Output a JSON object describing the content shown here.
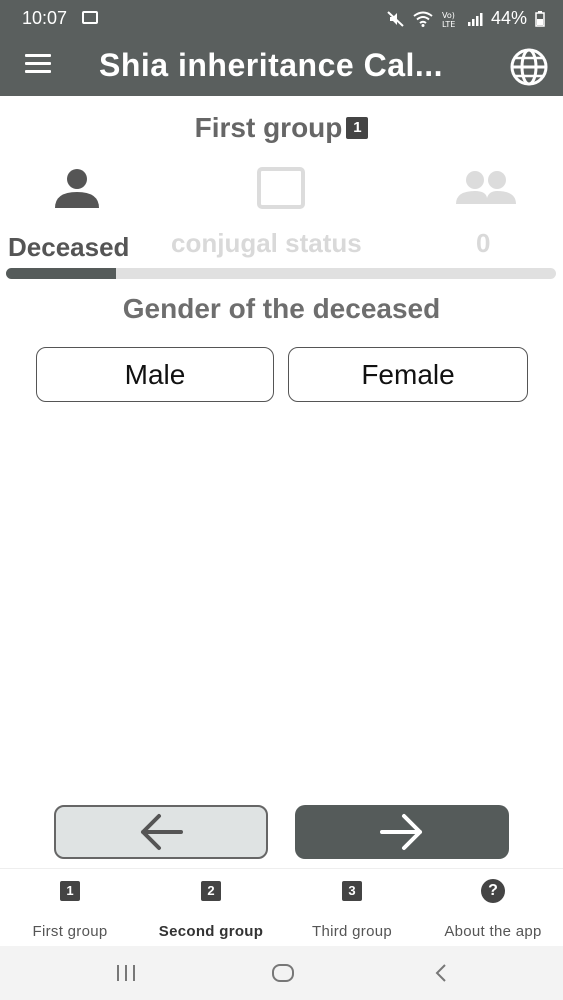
{
  "status_bar": {
    "time": "10:07",
    "battery": "44%",
    "icons": [
      "image-icon",
      "mute-icon",
      "wifi-icon",
      "volte-icon",
      "signal-icon",
      "battery-icon"
    ]
  },
  "app_bar": {
    "title": "Shia inheritance Cal...",
    "menu_icon": "menu-icon",
    "language_icon": "globe-icon"
  },
  "header": {
    "group_title": "First group",
    "group_badge": "1"
  },
  "steps": [
    {
      "label": "Deceased",
      "icon": "person-icon",
      "active": true
    },
    {
      "label": "conjugal status",
      "icon": "checkbox-icon",
      "active": false
    },
    {
      "label": "0",
      "icon": "people-icon",
      "active": false
    }
  ],
  "progress": {
    "fraction": 0.2
  },
  "question": "Gender of the deceased",
  "choices": {
    "male": "Male",
    "female": "Female"
  },
  "nav_buttons": {
    "back_icon": "arrow-left-icon",
    "next_icon": "arrow-right-icon"
  },
  "bottom_nav": [
    {
      "badge": "1",
      "label": "First group",
      "active": false
    },
    {
      "badge": "2",
      "label": "Second group",
      "active": true
    },
    {
      "badge": "3",
      "label": "Third group",
      "active": false
    },
    {
      "badge": "?",
      "label": "About the app",
      "active": false
    }
  ],
  "colors": {
    "app_bar": "#5a5f5e",
    "accent_dark": "#555b5a",
    "inactive_text": "#d9d9d9",
    "back_button_bg": "#dfe3e3"
  }
}
